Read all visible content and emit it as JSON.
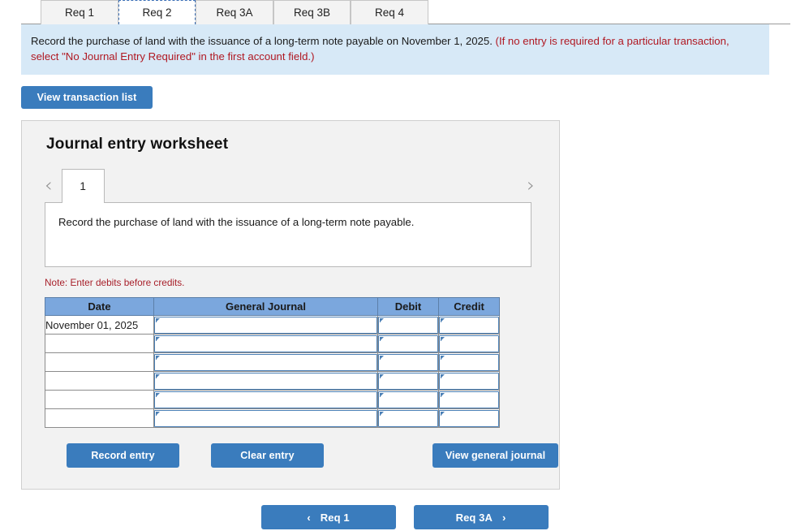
{
  "tabs": [
    {
      "label": "Req 1",
      "active": false
    },
    {
      "label": "Req 2",
      "active": true
    },
    {
      "label": "Req 3A",
      "active": false
    },
    {
      "label": "Req 3B",
      "active": false
    },
    {
      "label": "Req 4",
      "active": false
    }
  ],
  "banner": {
    "main_text": "Record the purchase of land with the issuance of a long-term note payable on November 1, 2025.",
    "requirement_text": "(If no entry is required for a particular transaction, select \"No Journal Entry Required\" in the first account field.)"
  },
  "toolbar": {
    "view_transaction_list_label": "View transaction list"
  },
  "worksheet": {
    "title": "Journal entry worksheet",
    "pager": {
      "prev_icon": "‹",
      "next_icon": "›",
      "current_page": "1"
    },
    "description": "Record the purchase of land with the issuance of a long-term note payable.",
    "note": "Note: Enter debits before credits.",
    "table": {
      "headers": [
        "Date",
        "General Journal",
        "Debit",
        "Credit"
      ],
      "rows": [
        {
          "date": "November 01, 2025",
          "general_journal": "",
          "debit": "",
          "credit": ""
        },
        {
          "date": "",
          "general_journal": "",
          "debit": "",
          "credit": ""
        },
        {
          "date": "",
          "general_journal": "",
          "debit": "",
          "credit": ""
        },
        {
          "date": "",
          "general_journal": "",
          "debit": "",
          "credit": ""
        },
        {
          "date": "",
          "general_journal": "",
          "debit": "",
          "credit": ""
        },
        {
          "date": "",
          "general_journal": "",
          "debit": "",
          "credit": ""
        }
      ]
    },
    "actions": {
      "record_entry_label": "Record entry",
      "clear_entry_label": "Clear entry",
      "view_general_journal_label": "View general journal"
    }
  },
  "bottom_nav": {
    "prev_icon": "‹",
    "prev_label": "Req 1",
    "next_label": "Req 3A",
    "next_icon": "›"
  },
  "colors": {
    "button_blue": "#3a7cbd",
    "banner_blue": "#d7e9f7",
    "table_header_blue": "#7ba7dd",
    "note_red": "#a8212b",
    "panel_gray": "#f2f2f2"
  }
}
